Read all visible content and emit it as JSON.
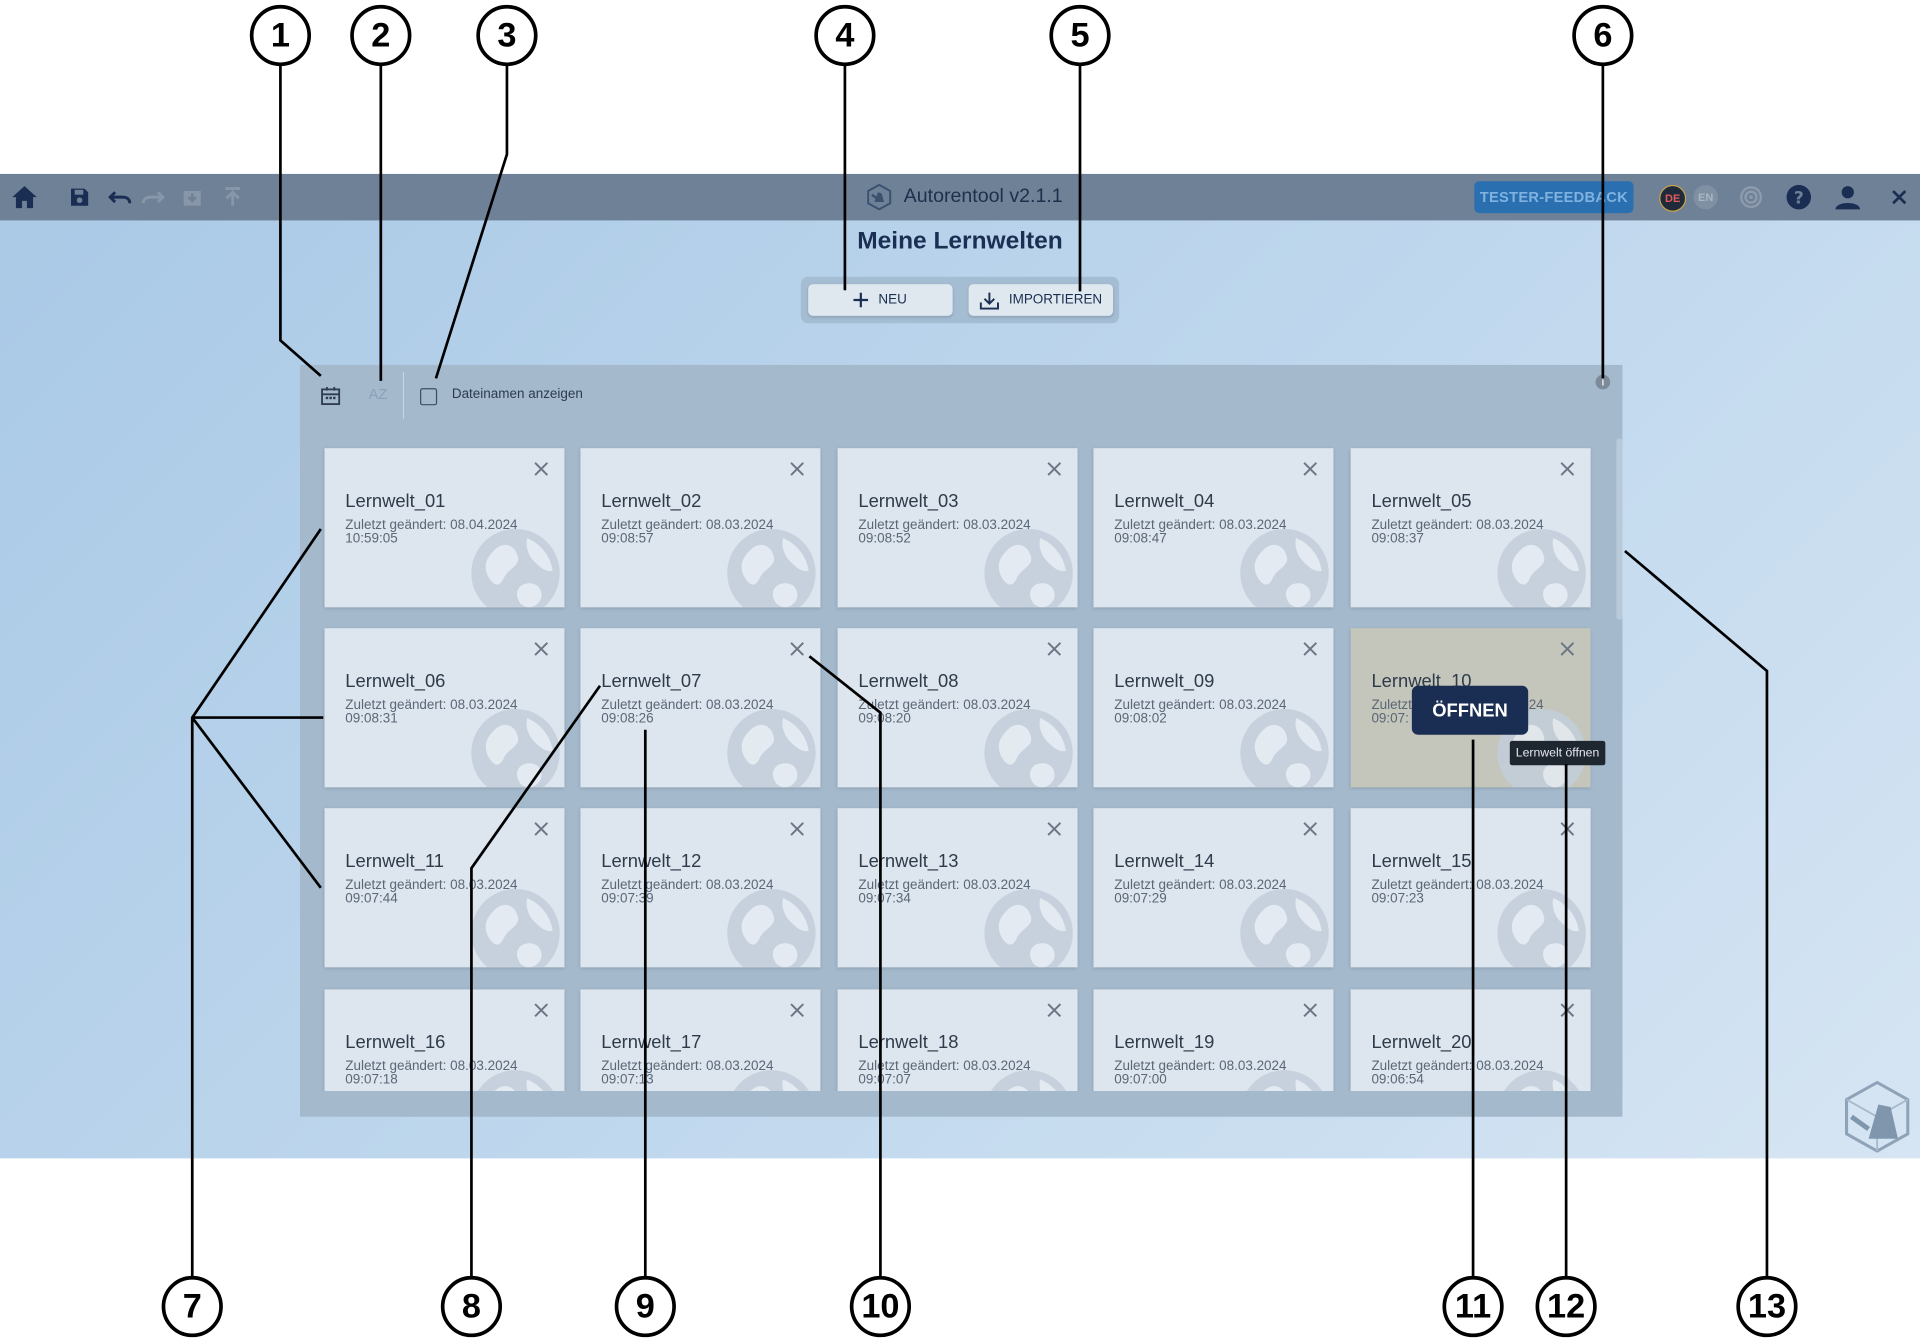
{
  "titlebar": {
    "app_title": "Autorentool v2.1.1",
    "feedback_label": "TESTER-FEEDBACK",
    "lang_de": "DE",
    "lang_en": "EN"
  },
  "page": {
    "heading": "Meine Lernwelten",
    "new_label": "NEU",
    "import_label": "IMPORTIEREN"
  },
  "toolbar": {
    "sort_az_label": "AZ",
    "show_filenames_label": "Dateinamen anzeigen",
    "show_filenames_checked": false,
    "info_glyph": "i"
  },
  "worlds": [
    {
      "title": "Lernwelt_01",
      "modified": "Zuletzt geändert: 08.04.2024",
      "time": "10:59:05"
    },
    {
      "title": "Lernwelt_02",
      "modified": "Zuletzt geändert: 08.03.2024",
      "time": "09:08:57"
    },
    {
      "title": "Lernwelt_03",
      "modified": "Zuletzt geändert: 08.03.2024",
      "time": "09:08:52"
    },
    {
      "title": "Lernwelt_04",
      "modified": "Zuletzt geändert: 08.03.2024",
      "time": "09:08:47"
    },
    {
      "title": "Lernwelt_05",
      "modified": "Zuletzt geändert: 08.03.2024",
      "time": "09:08:37"
    },
    {
      "title": "Lernwelt_06",
      "modified": "Zuletzt geändert: 08.03.2024",
      "time": "09:08:31"
    },
    {
      "title": "Lernwelt_07",
      "modified": "Zuletzt geändert: 08.03.2024",
      "time": "09:08:26"
    },
    {
      "title": "Lernwelt_08",
      "modified": "Zuletzt geändert: 08.03.2024",
      "time": "09:08:20"
    },
    {
      "title": "Lernwelt_09",
      "modified": "Zuletzt geändert: 08.03.2024",
      "time": "09:08:02"
    },
    {
      "title": "Lernwelt_10",
      "modified": "Zuletzt geändert: 08.03.2024",
      "time": "09:07:",
      "hovered": true
    },
    {
      "title": "Lernwelt_11",
      "modified": "Zuletzt geändert: 08.03.2024",
      "time": "09:07:44"
    },
    {
      "title": "Lernwelt_12",
      "modified": "Zuletzt geändert: 08.03.2024",
      "time": "09:07:39"
    },
    {
      "title": "Lernwelt_13",
      "modified": "Zuletzt geändert: 08.03.2024",
      "time": "09:07:34"
    },
    {
      "title": "Lernwelt_14",
      "modified": "Zuletzt geändert: 08.03.2024",
      "time": "09:07:29"
    },
    {
      "title": "Lernwelt_15",
      "modified": "Zuletzt geändert: 08.03.2024",
      "time": "09:07:23"
    },
    {
      "title": "Lernwelt_16",
      "modified": "Zuletzt geändert: 08.03.2024",
      "time": "09:07:18"
    },
    {
      "title": "Lernwelt_17",
      "modified": "Zuletzt geändert: 08.03.2024",
      "time": "09:07:13"
    },
    {
      "title": "Lernwelt_18",
      "modified": "Zuletzt geändert: 08.03.2024",
      "time": "09:07:07"
    },
    {
      "title": "Lernwelt_19",
      "modified": "Zuletzt geändert: 08.03.2024",
      "time": "09:07:00"
    },
    {
      "title": "Lernwelt_20",
      "modified": "Zuletzt geändert: 08.03.2024",
      "time": "09:06:54"
    }
  ],
  "hover_card": {
    "open_label": "ÖFFNEN",
    "tooltip": "Lernwelt öffnen"
  },
  "callouts": [
    "1",
    "2",
    "3",
    "4",
    "5",
    "6",
    "7",
    "8",
    "9",
    "10",
    "11",
    "12",
    "13"
  ],
  "colors": {
    "titlebar": "#6f8197",
    "accent_dark": "#1a2d52",
    "feedback": "#2a6fb0",
    "card": "#dde5ee",
    "card_hover": "#c4c5bb",
    "panel": "#a4b9cc"
  },
  "icons": [
    "home-icon",
    "save-icon",
    "undo-icon",
    "redo-icon",
    "export-icon",
    "upload-icon",
    "app-logo-icon",
    "target-icon",
    "help-icon",
    "user-icon",
    "close-icon",
    "plus-icon",
    "download-icon",
    "calendar-icon",
    "info-icon",
    "globe-icon"
  ]
}
